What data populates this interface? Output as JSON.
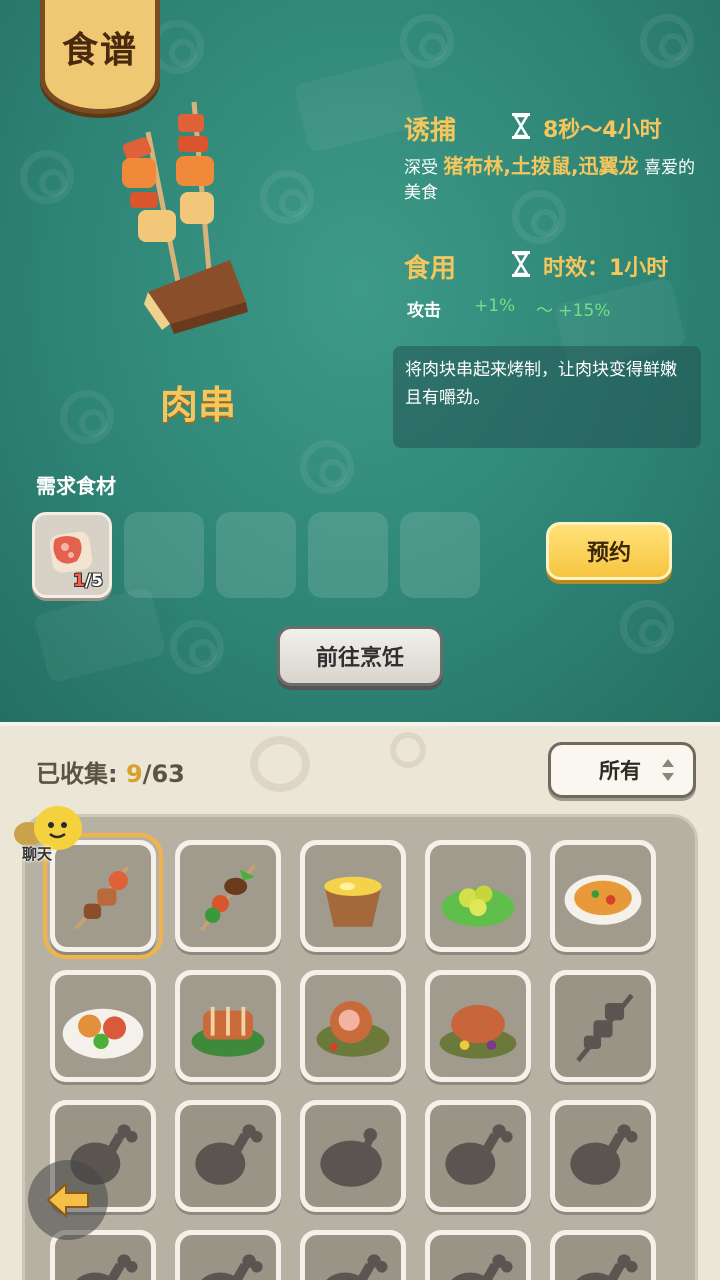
{
  "header": {
    "badge": "食谱"
  },
  "dish": {
    "name": "肉串"
  },
  "lure": {
    "title": "诱捕",
    "time": "8秒～4小时",
    "desc_prefix": "深受",
    "desc_targets": "猪布林,土拨鼠,迅翼龙",
    "desc_suffix": "喜爱的美食"
  },
  "eat": {
    "title": "食用",
    "time": "时效：1小时",
    "stat_label": "攻击",
    "stat_min": "+1%",
    "stat_max": "～ +15%"
  },
  "description": "将肉块串起来烤制，让肉块变得鲜嫩且有嚼劲。",
  "ingredients": {
    "label": "需求食材",
    "slots": [
      {
        "icon": "meat-icon",
        "count_current": "1",
        "count_total": "/5"
      },
      {
        "icon": ""
      },
      {
        "icon": ""
      },
      {
        "icon": ""
      },
      {
        "icon": ""
      }
    ]
  },
  "buttons": {
    "reserve": "预约",
    "cook": "前往烹饪"
  },
  "collection": {
    "label": "已收集:",
    "current": "9",
    "total": "/63",
    "filter": "所有"
  },
  "chat": {
    "label": "聊天"
  },
  "recipes": [
    {
      "icon": "meat-skewer-icon",
      "unlocked": true,
      "selected": true
    },
    {
      "icon": "mushroom-skewer-icon",
      "unlocked": true
    },
    {
      "icon": "soup-bowl-icon",
      "unlocked": true
    },
    {
      "icon": "fruit-plate-icon",
      "unlocked": true
    },
    {
      "icon": "pizza-plate-icon",
      "unlocked": true
    },
    {
      "icon": "salad-plate-icon",
      "unlocked": true
    },
    {
      "icon": "roast-ribs-icon",
      "unlocked": true
    },
    {
      "icon": "roast-ham-icon",
      "unlocked": true
    },
    {
      "icon": "roast-feast-icon",
      "unlocked": true
    },
    {
      "icon": "skewer-silhouette-icon",
      "unlocked": false
    },
    {
      "icon": "drumstick-silhouette-icon",
      "unlocked": false
    },
    {
      "icon": "drumstick-silhouette-icon",
      "unlocked": false
    },
    {
      "icon": "roast-chicken-silhouette-icon",
      "unlocked": false
    },
    {
      "icon": "drumstick-silhouette-icon",
      "unlocked": false
    },
    {
      "icon": "drumstick-silhouette-icon",
      "unlocked": false
    }
  ],
  "colors": {
    "accent_gold": "#f4c65c",
    "stat_green": "#6fe08a",
    "count_red": "#ff5a4a"
  }
}
